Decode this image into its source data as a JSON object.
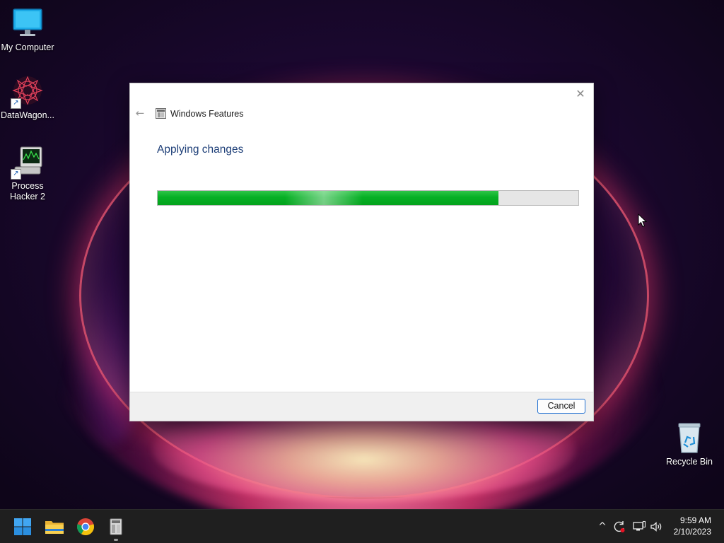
{
  "desktop": {
    "icons": [
      {
        "label": "My Computer",
        "icon": "computer-monitor-icon"
      },
      {
        "label": "DataWagon...",
        "icon": "datawagon-star-icon"
      },
      {
        "label": "Process\nHacker 2",
        "icon": "process-hacker-icon"
      },
      {
        "label": "Recycle Bin",
        "icon": "recycle-bin-icon"
      }
    ]
  },
  "dialog": {
    "title": "Windows Features",
    "heading": "Applying changes",
    "progress_fraction": 0.81,
    "cancel_label": "Cancel",
    "close_glyph": "✕",
    "back_glyph": "←"
  },
  "taskbar": {
    "apps": [
      {
        "name": "Start",
        "icon": "windows-start-icon"
      },
      {
        "name": "File Explorer",
        "icon": "folder-icon"
      },
      {
        "name": "Google Chrome",
        "icon": "chrome-icon"
      },
      {
        "name": "Windows Features",
        "icon": "windows-features-icon"
      }
    ],
    "tray": {
      "overflow_glyph": "^",
      "icons": [
        "sync-icon",
        "network-icon",
        "volume-icon"
      ]
    },
    "clock": {
      "time": "9:59 AM",
      "date": "2/10/2023"
    }
  },
  "colors": {
    "progress_green": "#06b025",
    "heading_blue": "#1e3f78",
    "button_border": "#1f6fd1",
    "taskbar_bg": "#1f1f1f"
  }
}
